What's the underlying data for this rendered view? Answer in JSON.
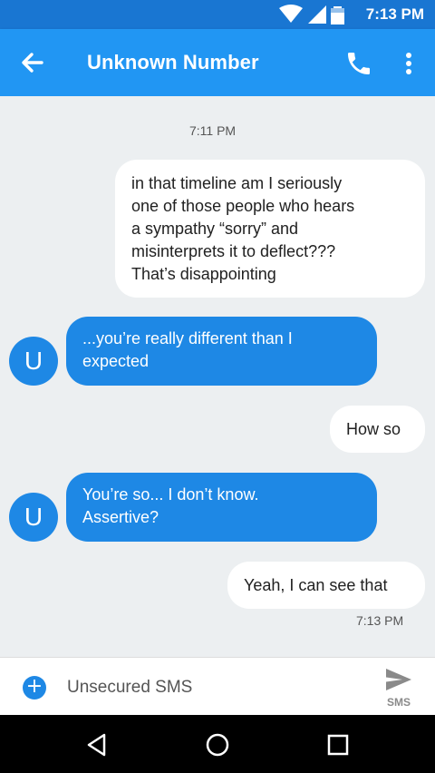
{
  "status_bar": {
    "time": "7:13 PM",
    "icons": [
      "wifi-icon",
      "signal-icon",
      "battery-icon"
    ]
  },
  "app_bar": {
    "title": "Unknown Number",
    "back_icon": "arrow-left-icon",
    "call_icon": "phone-icon",
    "more_icon": "more-vert-icon"
  },
  "thread": {
    "timestamp_top": "7:11 PM",
    "messages": [
      {
        "direction": "outgoing",
        "lines": [
          "in that timeline am I seriously",
          "one of those people who hears",
          "a sympathy “sorry” and",
          "misinterprets it to deflect???",
          "That’s disappointing"
        ]
      },
      {
        "direction": "incoming",
        "avatar": "U",
        "lines": [
          "...you’re really different than I",
          "expected"
        ]
      },
      {
        "direction": "outgoing",
        "lines": [
          "How so"
        ]
      },
      {
        "direction": "incoming",
        "avatar": "U",
        "lines": [
          "You’re so... I don’t know.",
          "Assertive?"
        ]
      },
      {
        "direction": "outgoing",
        "lines": [
          "Yeah, I can see that"
        ]
      }
    ],
    "timestamp_bottom": "7:13 PM"
  },
  "composer": {
    "placeholder": "Unsecured SMS",
    "value": "",
    "send_label": "SMS",
    "add_icon": "plus-circle-icon",
    "send_icon": "send-icon"
  },
  "nav_bar": {
    "icons": [
      "back-triangle-icon",
      "home-circle-icon",
      "recents-square-icon"
    ]
  },
  "colors": {
    "status_bar": "#1976d2",
    "app_bar": "#2196f3",
    "incoming_bubble": "#1e88e5",
    "outgoing_bubble": "#ffffff",
    "thread_background": "#eceff1"
  }
}
